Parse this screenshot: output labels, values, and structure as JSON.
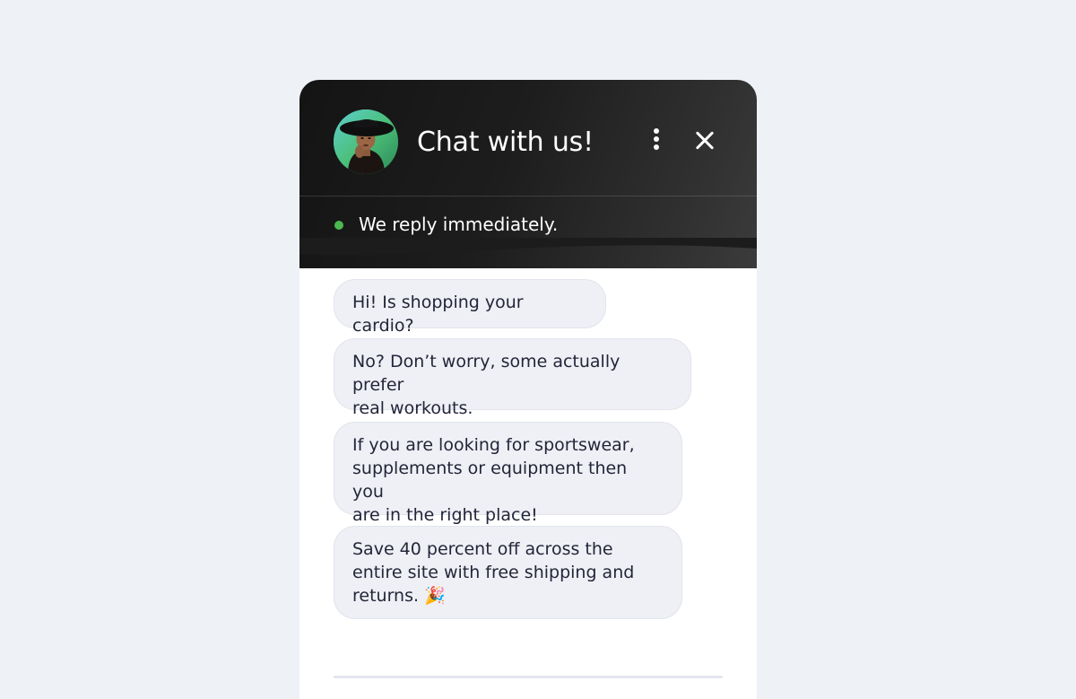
{
  "chat": {
    "title": "Chat with us!",
    "status_text": "We reply immediately.",
    "status_color": "#4cb84f",
    "header_colors": [
      "#141414",
      "#3b3b3b"
    ],
    "bubble_color": "#eff0f5",
    "messages": [
      "Hi! Is shopping your cardio?",
      "No? Don’t worry, some actually prefer\nreal workouts.",
      "If you are looking for sportswear,\nsupplements or equipment then you\nare in the right place!",
      "Save 40 percent off across the\nentire site with free shipping and\nreturns. 🎉"
    ]
  },
  "icons": {
    "avatar": "agent-avatar",
    "menu": "more-vertical-icon",
    "close": "close-icon",
    "status": "online-dot-icon"
  }
}
